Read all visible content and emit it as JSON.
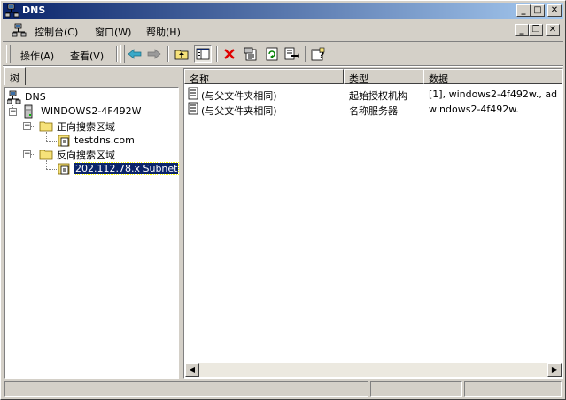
{
  "window": {
    "title": "DNS",
    "controls": {
      "minimize": "_",
      "maximize": "□",
      "close": "✕"
    }
  },
  "menubar": {
    "items": [
      {
        "label": "控制台(C)"
      },
      {
        "label": "窗口(W)"
      },
      {
        "label": "帮助(H)"
      }
    ],
    "mdi_controls": {
      "minimize": "_",
      "restore": "❐",
      "close": "✕"
    }
  },
  "toolbar": {
    "action_label": "操作(A)",
    "view_label": "查看(V)"
  },
  "tree_panel": {
    "tab_label": "树",
    "nodes": [
      {
        "label": "DNS"
      },
      {
        "label": "WINDOWS2-4F492W"
      },
      {
        "label": "正向搜索区域"
      },
      {
        "label": "testdns.com"
      },
      {
        "label": "反向搜索区域"
      },
      {
        "label": "202.112.78.x Subnet"
      }
    ]
  },
  "list_panel": {
    "columns": [
      "名称",
      "类型",
      "数据"
    ],
    "rows": [
      {
        "name": "(与父文件夹相同)",
        "type": "起始授权机构",
        "data": "[1], windows2-4f492w., ad..."
      },
      {
        "name": "(与父文件夹相同)",
        "type": "名称服务器",
        "data": "windows2-4f492w."
      }
    ]
  },
  "colors": {
    "title_start": "#0a246a",
    "title_end": "#a6caf0",
    "selection": "#0a246a",
    "face": "#d4d0c8"
  }
}
